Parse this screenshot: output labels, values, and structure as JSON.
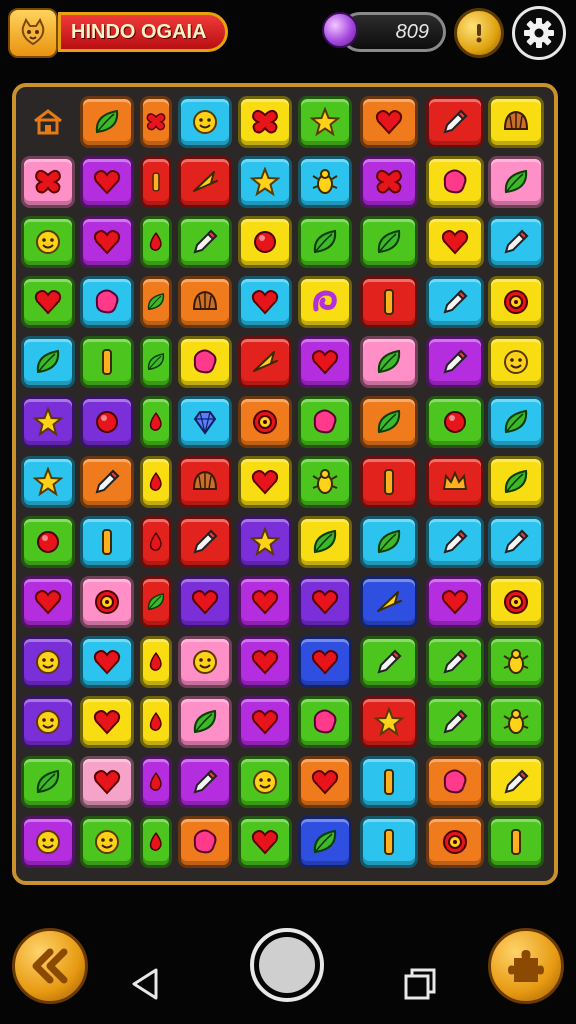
{
  "header": {
    "title": "HINDO OGAIA",
    "score": "809",
    "accent": "#e8a10f",
    "title_color": "#d81e22"
  },
  "board": {
    "rows": 13,
    "cols": 9,
    "palette": {
      "O": "#f07b1c",
      "R": "#e2231d",
      "C": "#2cc3ee",
      "Y": "#f7dd12",
      "G": "#4cc51f",
      "P": "#ff8fc7",
      "M": "#b42ee0",
      "V": "#7b2fd8",
      "B": "#2f4fe0",
      "K": "#f5a3c8"
    },
    "tiles": [
      [
        [
          "none",
          "home-icon"
        ],
        [
          "O",
          "leaf-icon"
        ],
        [
          "O",
          "butterfly-icon"
        ],
        [
          "C",
          "smile-icon"
        ],
        [
          "Y",
          "butterfly-icon"
        ],
        [
          "G",
          "star-icon"
        ],
        [
          "O",
          "heart-icon"
        ],
        [
          "R",
          "pencil-icon"
        ],
        [
          "Y",
          "shell-icon"
        ]
      ],
      [
        [
          "P",
          "butterfly-icon"
        ],
        [
          "M",
          "heart-icon"
        ],
        [
          "R",
          "bar-icon"
        ],
        [
          "R",
          "arrow-icon"
        ],
        [
          "C",
          "star-icon"
        ],
        [
          "C",
          "bug-icon"
        ],
        [
          "M",
          "butterfly-icon"
        ],
        [
          "Y",
          "blob-icon"
        ],
        [
          "P",
          "leaf-icon"
        ]
      ],
      [
        [
          "G",
          "smile-icon"
        ],
        [
          "M",
          "heart-icon"
        ],
        [
          "G",
          "drop-icon"
        ],
        [
          "G",
          "pencil-icon"
        ],
        [
          "Y",
          "circle-icon"
        ],
        [
          "G",
          "leaf-icon"
        ],
        [
          "G",
          "leaf-icon"
        ],
        [
          "Y",
          "heart-icon"
        ],
        [
          "C",
          "pencil-icon"
        ]
      ],
      [
        [
          "G",
          "heart-icon"
        ],
        [
          "C",
          "blob-icon"
        ],
        [
          "O",
          "leaf-icon"
        ],
        [
          "O",
          "shell-icon"
        ],
        [
          "C",
          "heart-icon"
        ],
        [
          "Y",
          "swirl-icon"
        ],
        [
          "R",
          "bar-icon"
        ],
        [
          "C",
          "pencil-icon"
        ],
        [
          "Y",
          "target-icon"
        ]
      ],
      [
        [
          "C",
          "leaf-icon"
        ],
        [
          "G",
          "bar-icon"
        ],
        [
          "G",
          "leaf-icon"
        ],
        [
          "Y",
          "blob-icon"
        ],
        [
          "R",
          "arrow-icon"
        ],
        [
          "M",
          "heart-icon"
        ],
        [
          "P",
          "leaf-icon"
        ],
        [
          "M",
          "pencil-icon"
        ],
        [
          "Y",
          "smile-icon"
        ]
      ],
      [
        [
          "V",
          "star-icon"
        ],
        [
          "V",
          "circle-icon"
        ],
        [
          "G",
          "drop-icon"
        ],
        [
          "C",
          "gem-icon"
        ],
        [
          "O",
          "target-icon"
        ],
        [
          "G",
          "blob-icon"
        ],
        [
          "O",
          "leaf-icon"
        ],
        [
          "G",
          "circle-icon"
        ],
        [
          "C",
          "leaf-icon"
        ]
      ],
      [
        [
          "C",
          "star-icon"
        ],
        [
          "O",
          "pencil-icon"
        ],
        [
          "Y",
          "drop-icon"
        ],
        [
          "R",
          "shell-icon"
        ],
        [
          "Y",
          "heart-icon"
        ],
        [
          "G",
          "bug-icon"
        ],
        [
          "R",
          "bar-icon"
        ],
        [
          "R",
          "crown-icon"
        ],
        [
          "Y",
          "leaf-icon"
        ]
      ],
      [
        [
          "G",
          "circle-icon"
        ],
        [
          "C",
          "bar-icon"
        ],
        [
          "R",
          "drop-icon"
        ],
        [
          "R",
          "pencil-icon"
        ],
        [
          "V",
          "star-icon"
        ],
        [
          "Y",
          "leaf-icon"
        ],
        [
          "C",
          "leaf-icon"
        ],
        [
          "C",
          "pencil-icon"
        ],
        [
          "C",
          "pencil-icon"
        ]
      ],
      [
        [
          "M",
          "heart-icon"
        ],
        [
          "P",
          "target-icon"
        ],
        [
          "R",
          "leaf-icon"
        ],
        [
          "V",
          "heart-icon"
        ],
        [
          "M",
          "heart-icon"
        ],
        [
          "V",
          "heart-icon"
        ],
        [
          "B",
          "arrow-icon"
        ],
        [
          "M",
          "heart-icon"
        ],
        [
          "Y",
          "target-icon"
        ]
      ],
      [
        [
          "V",
          "smile-icon"
        ],
        [
          "C",
          "heart-icon"
        ],
        [
          "Y",
          "drop-icon"
        ],
        [
          "P",
          "smile-icon"
        ],
        [
          "M",
          "heart-icon"
        ],
        [
          "B",
          "heart-icon"
        ],
        [
          "G",
          "pencil-icon"
        ],
        [
          "G",
          "pencil-icon"
        ],
        [
          "G",
          "bug-icon"
        ]
      ],
      [
        [
          "V",
          "smile-icon"
        ],
        [
          "Y",
          "heart-icon"
        ],
        [
          "Y",
          "drop-icon"
        ],
        [
          "P",
          "leaf-icon"
        ],
        [
          "M",
          "heart-icon"
        ],
        [
          "G",
          "blob-icon"
        ],
        [
          "R",
          "star-icon"
        ],
        [
          "G",
          "pencil-icon"
        ],
        [
          "G",
          "bug-icon"
        ]
      ],
      [
        [
          "G",
          "leaf-icon"
        ],
        [
          "K",
          "heart-icon"
        ],
        [
          "M",
          "drop-icon"
        ],
        [
          "M",
          "pencil-icon"
        ],
        [
          "G",
          "smile-icon"
        ],
        [
          "O",
          "heart-icon"
        ],
        [
          "C",
          "bar-icon"
        ],
        [
          "O",
          "blob-icon"
        ],
        [
          "Y",
          "pencil-icon"
        ]
      ],
      [
        [
          "M",
          "smile-icon"
        ],
        [
          "G",
          "smile-icon"
        ],
        [
          "G",
          "drop-icon"
        ],
        [
          "O",
          "blob-icon"
        ],
        [
          "G",
          "heart-icon"
        ],
        [
          "B",
          "leaf-icon"
        ],
        [
          "C",
          "bar-icon"
        ],
        [
          "O",
          "target-icon"
        ],
        [
          "G",
          "bar-icon"
        ]
      ]
    ]
  }
}
